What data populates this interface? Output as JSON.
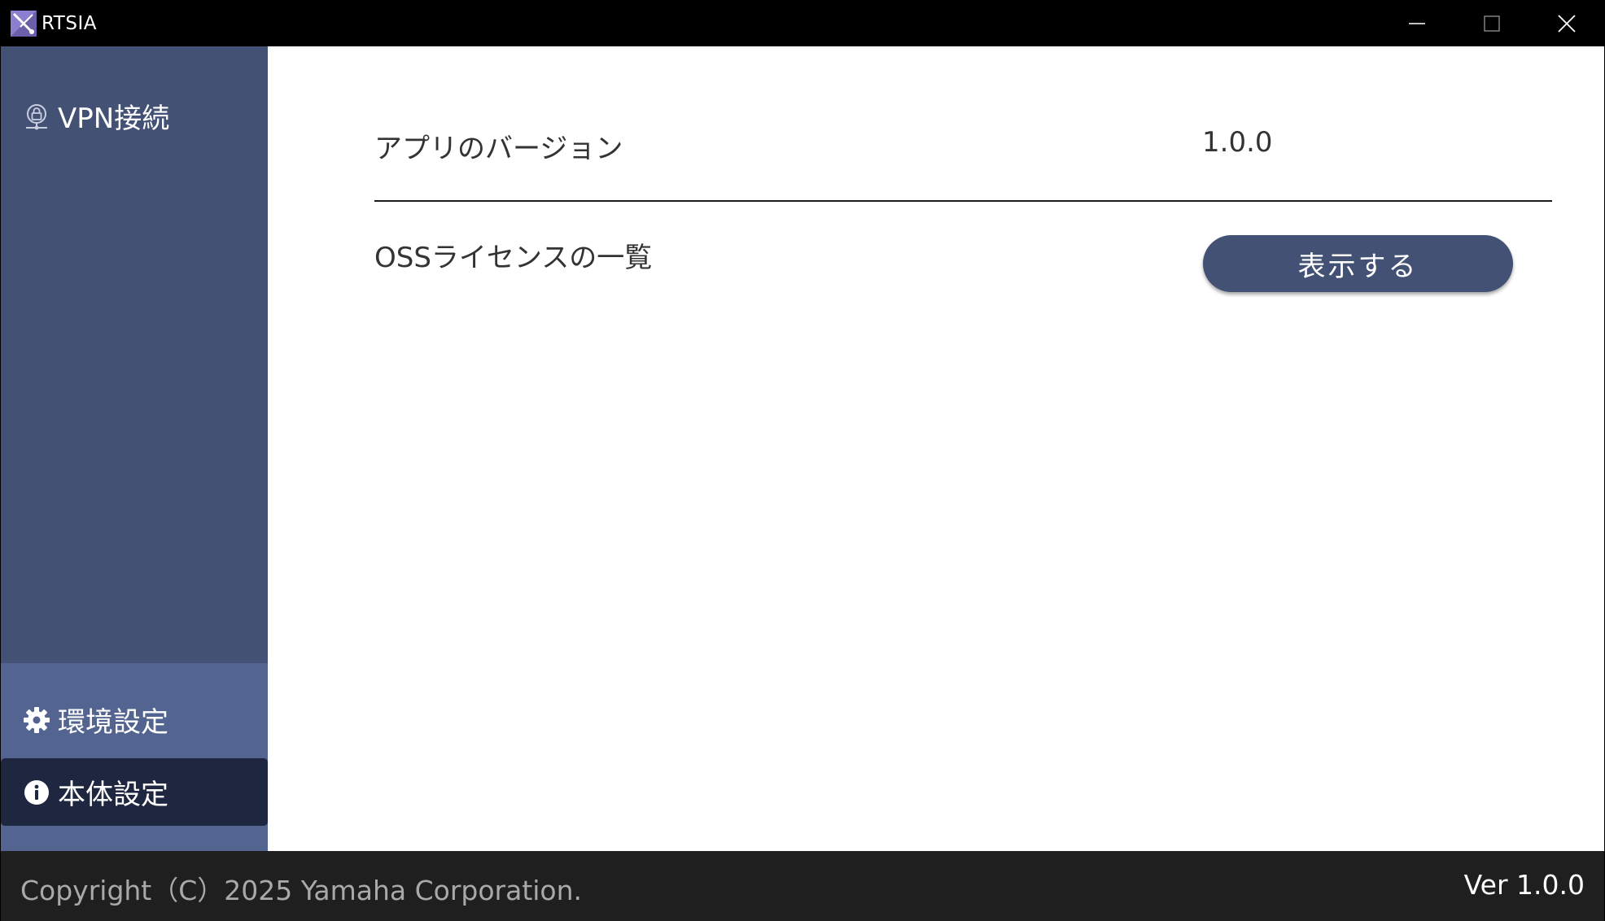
{
  "window": {
    "title": "RTSIA",
    "logo_icon": "rtsia-logo-icon",
    "controls": {
      "minimize_icon": "minimize-icon",
      "maximize_icon": "maximize-icon",
      "close_icon": "close-icon"
    }
  },
  "sidebar": {
    "items": [
      {
        "label": "VPN接続",
        "icon": "vpn-lock-icon",
        "selected": false
      },
      {
        "label": "環境設定",
        "icon": "gear-icon",
        "selected": false
      },
      {
        "label": "本体設定",
        "icon": "info-icon",
        "selected": true
      }
    ]
  },
  "main": {
    "version_row": {
      "label": "アプリのバージョン",
      "value": "1.0.0"
    },
    "oss_row": {
      "label": "OSSライセンスの一覧",
      "button_label": "表示する"
    }
  },
  "footer": {
    "copyright": "Copyright（C）2025 Yamaha Corporation.",
    "version": "Ver 1.0.0"
  },
  "colors": {
    "sidebar": "#435175",
    "sidebar_lower": "#52648f",
    "selected_item": "#1f2740",
    "footer": "#1f1f1f",
    "button": "#435175"
  }
}
